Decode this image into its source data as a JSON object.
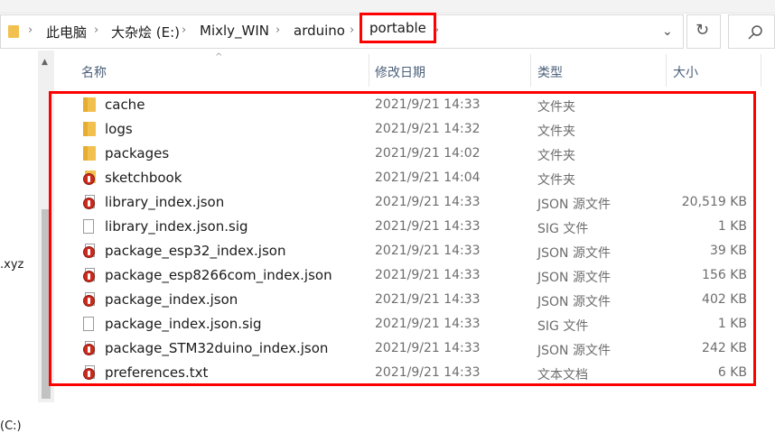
{
  "address": {
    "crumbs": [
      "此电脑",
      "大杂烩 (E:)",
      "Mixly_WIN",
      "arduino",
      "portable"
    ],
    "separator": "›",
    "dropdown": "⌄",
    "refresh": "↻"
  },
  "columns": {
    "name": "名称",
    "modified": "修改日期",
    "type": "类型",
    "size": "大小"
  },
  "nav": {
    "items": [
      ".xyz",
      "(C:)"
    ]
  },
  "files": [
    {
      "name": "cache",
      "date": "2021/9/21 14:33",
      "type": "文件夹",
      "size": "",
      "icon": "folder-icon"
    },
    {
      "name": "logs",
      "date": "2021/9/21 14:32",
      "type": "文件夹",
      "size": "",
      "icon": "folder-icon"
    },
    {
      "name": "packages",
      "date": "2021/9/21 14:02",
      "type": "文件夹",
      "size": "",
      "icon": "folder-icon"
    },
    {
      "name": "sketchbook",
      "date": "2021/9/21 14:04",
      "type": "文件夹",
      "size": "",
      "icon": "arduino-folder-icon"
    },
    {
      "name": "library_index.json",
      "date": "2021/9/21 14:33",
      "type": "JSON 源文件",
      "size": "20,519 KB",
      "icon": "arduino-file-icon"
    },
    {
      "name": "library_index.json.sig",
      "date": "2021/9/21 14:33",
      "type": "SIG 文件",
      "size": "1 KB",
      "icon": "file-icon"
    },
    {
      "name": "package_esp32_index.json",
      "date": "2021/9/21 14:33",
      "type": "JSON 源文件",
      "size": "39 KB",
      "icon": "arduino-file-icon"
    },
    {
      "name": "package_esp8266com_index.json",
      "date": "2021/9/21 14:33",
      "type": "JSON 源文件",
      "size": "156 KB",
      "icon": "arduino-file-icon"
    },
    {
      "name": "package_index.json",
      "date": "2021/9/21 14:33",
      "type": "JSON 源文件",
      "size": "402 KB",
      "icon": "arduino-file-icon"
    },
    {
      "name": "package_index.json.sig",
      "date": "2021/9/21 14:33",
      "type": "SIG 文件",
      "size": "1 KB",
      "icon": "file-icon"
    },
    {
      "name": "package_STM32duino_index.json",
      "date": "2021/9/21 14:33",
      "type": "JSON 源文件",
      "size": "242 KB",
      "icon": "arduino-file-icon"
    },
    {
      "name": "preferences.txt",
      "date": "2021/9/21 14:33",
      "type": "文本文档",
      "size": "6 KB",
      "icon": "arduino-file-icon"
    }
  ],
  "colors": {
    "highlight": "#ff0000",
    "folder": "#f2c04f",
    "header_text": "#4c607a"
  }
}
